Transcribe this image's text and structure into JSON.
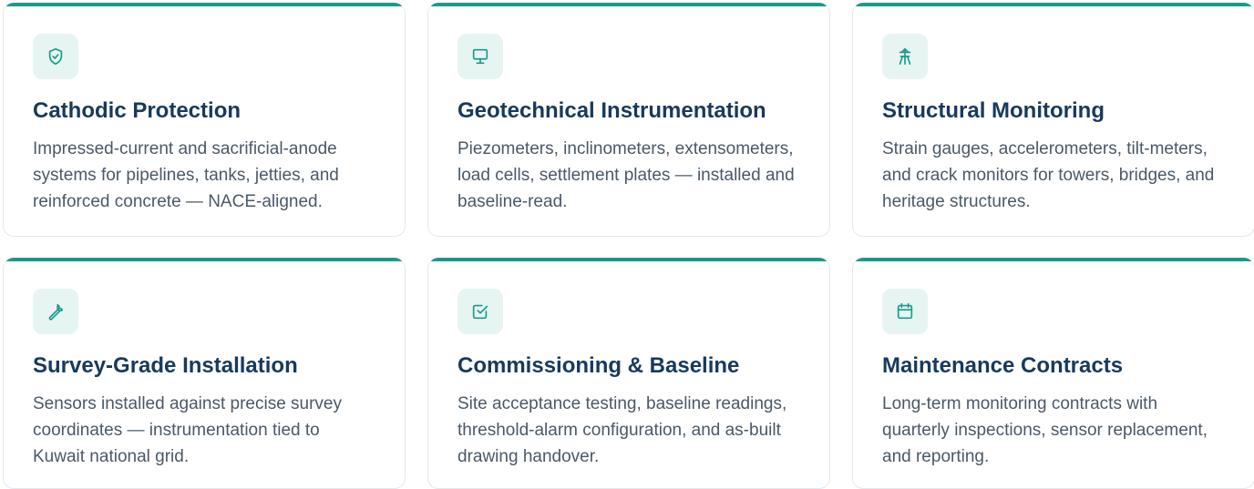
{
  "accent_color": "#1a9a8a",
  "title_color": "#173a5e",
  "cards": [
    {
      "icon": "shield-check-icon",
      "title": "Cathodic Protection",
      "description": "Impressed-current and sacrificial-anode systems for pipelines, tanks, jetties, and reinforced concrete — NACE-aligned."
    },
    {
      "icon": "monitor-icon",
      "title": "Geotechnical Instrumentation",
      "description": "Piezometers, inclinometers, extensometers, load cells, settlement plates — installed and baseline-read."
    },
    {
      "icon": "transmission-tower-icon",
      "title": "Structural Monitoring",
      "description": "Strain gauges, accelerometers, tilt-meters, and crack monitors for towers, bridges, and heritage structures."
    },
    {
      "icon": "wrench-icon",
      "title": "Survey-Grade Installation",
      "description": "Sensors installed against precise survey coordinates — instrumentation tied to Kuwait national grid."
    },
    {
      "icon": "checkbox-icon",
      "title": "Commissioning & Baseline",
      "description": "Site acceptance testing, baseline readings, threshold-alarm configuration, and as-built drawing handover."
    },
    {
      "icon": "calendar-icon",
      "title": "Maintenance Contracts",
      "description": "Long-term monitoring contracts with quarterly inspections, sensor replacement, and reporting."
    }
  ]
}
